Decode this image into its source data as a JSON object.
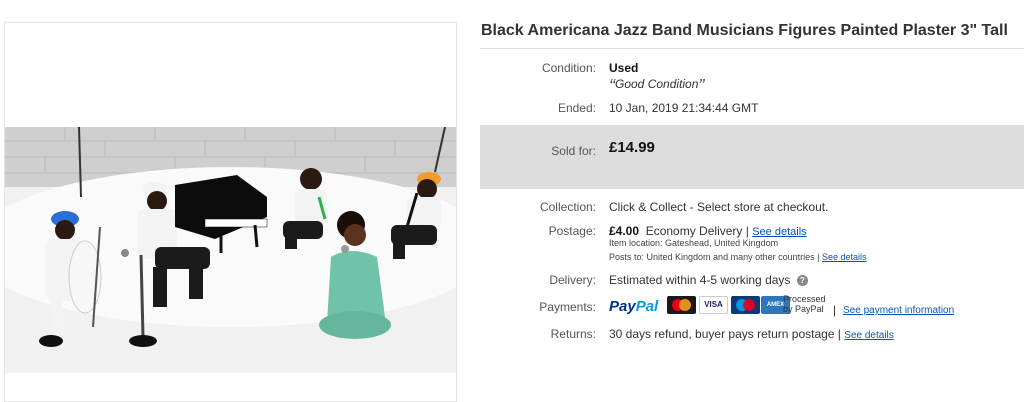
{
  "listing": {
    "title": "Black Americana Jazz Band Musicians Figures Painted Plaster 3\" Tall"
  },
  "details": {
    "condition_label": "Condition:",
    "condition_value": "Used",
    "condition_note": "Good Condition",
    "ended_label": "Ended:",
    "ended_value": "10 Jan, 2019  21:34:44 GMT",
    "sold_label": "Sold for:",
    "sold_price": "£14.99",
    "collection_label": "Collection:",
    "collection_value": "Click & Collect - Select store at checkout.",
    "postage_label": "Postage:",
    "postage_price": "£4.00",
    "postage_service": "Economy Delivery",
    "postage_sep": "|",
    "postage_link": "See details",
    "item_location": "Item location:  Gateshead, United Kingdom",
    "posts_to": "Posts to:  United Kingdom and many other countries",
    "posts_sep": "|",
    "posts_link": "See details",
    "delivery_label": "Delivery:",
    "delivery_value": "Estimated within 4-5 working days",
    "payments_label": "Payments:",
    "paypal_1": "Pay",
    "paypal_2": "Pal",
    "card_mastercard": "MC",
    "card_visa": "VISA",
    "card_maestro": "Maestro",
    "card_amex": "AMEX",
    "processed_1": "Processed",
    "processed_2": "by PayPal",
    "payments_sep": "|",
    "payments_link": "See payment information",
    "returns_label": "Returns:",
    "returns_value": "30 days refund, buyer pays return postage |",
    "returns_link": "See details"
  },
  "colors": {
    "link": "#0654ba",
    "sold_bg": "#dddddd",
    "paypal_dark": "#003087",
    "paypal_light": "#009cde"
  },
  "icons": {
    "help": "question-circle-icon"
  }
}
